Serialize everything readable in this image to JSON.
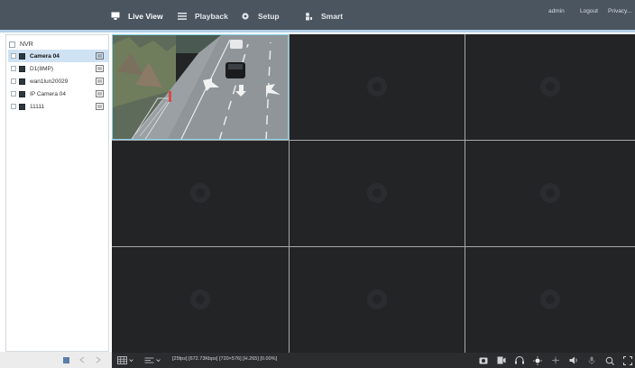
{
  "nav": {
    "items": [
      {
        "label": "Live View",
        "icon": "monitor-icon",
        "active": true
      },
      {
        "label": "Playback",
        "icon": "playback-icon",
        "active": false
      },
      {
        "label": "Setup",
        "icon": "gear-icon",
        "active": false
      },
      {
        "label": "Smart",
        "icon": "smart-person-icon",
        "active": false
      }
    ],
    "user": {
      "username": "admin",
      "logout": "Logout",
      "privacy": "Privacy..."
    }
  },
  "device_tree": {
    "root_label": "NVR",
    "items": [
      {
        "label": "Camera 04",
        "selected": true
      },
      {
        "label": "D1(8MP)",
        "selected": false
      },
      {
        "label": "wan1lun20029",
        "selected": false
      },
      {
        "label": "IP Camera 04",
        "selected": false
      },
      {
        "label": "11111",
        "selected": false
      }
    ]
  },
  "left_controls": {
    "buttons": [
      "stop-square-icon",
      "previous-icon",
      "next-icon"
    ]
  },
  "toolbar": {
    "layout_icon": "grid-layout-icon",
    "stream_icon": "stream-select-icon",
    "stats": "[25fps] [672.73Kbps] [720×576] [H.265] [0.00%]",
    "right_icons": [
      "snapshot-icon",
      "record-icon",
      "headset-icon",
      "brightness-icon",
      "zoom-icon",
      "speaker-icon",
      "microphone-icon",
      "digital-zoom-icon",
      "fullscreen-icon"
    ]
  },
  "video": {
    "layout": "3x3",
    "active_cell": 0,
    "channels": 9
  },
  "colors": {
    "topbar": "#4b5560",
    "accent_line": "#b3cfe6",
    "selected_row": "#cfe2f3",
    "video_bg": "#222426",
    "active_border": "#8fd0e6"
  }
}
